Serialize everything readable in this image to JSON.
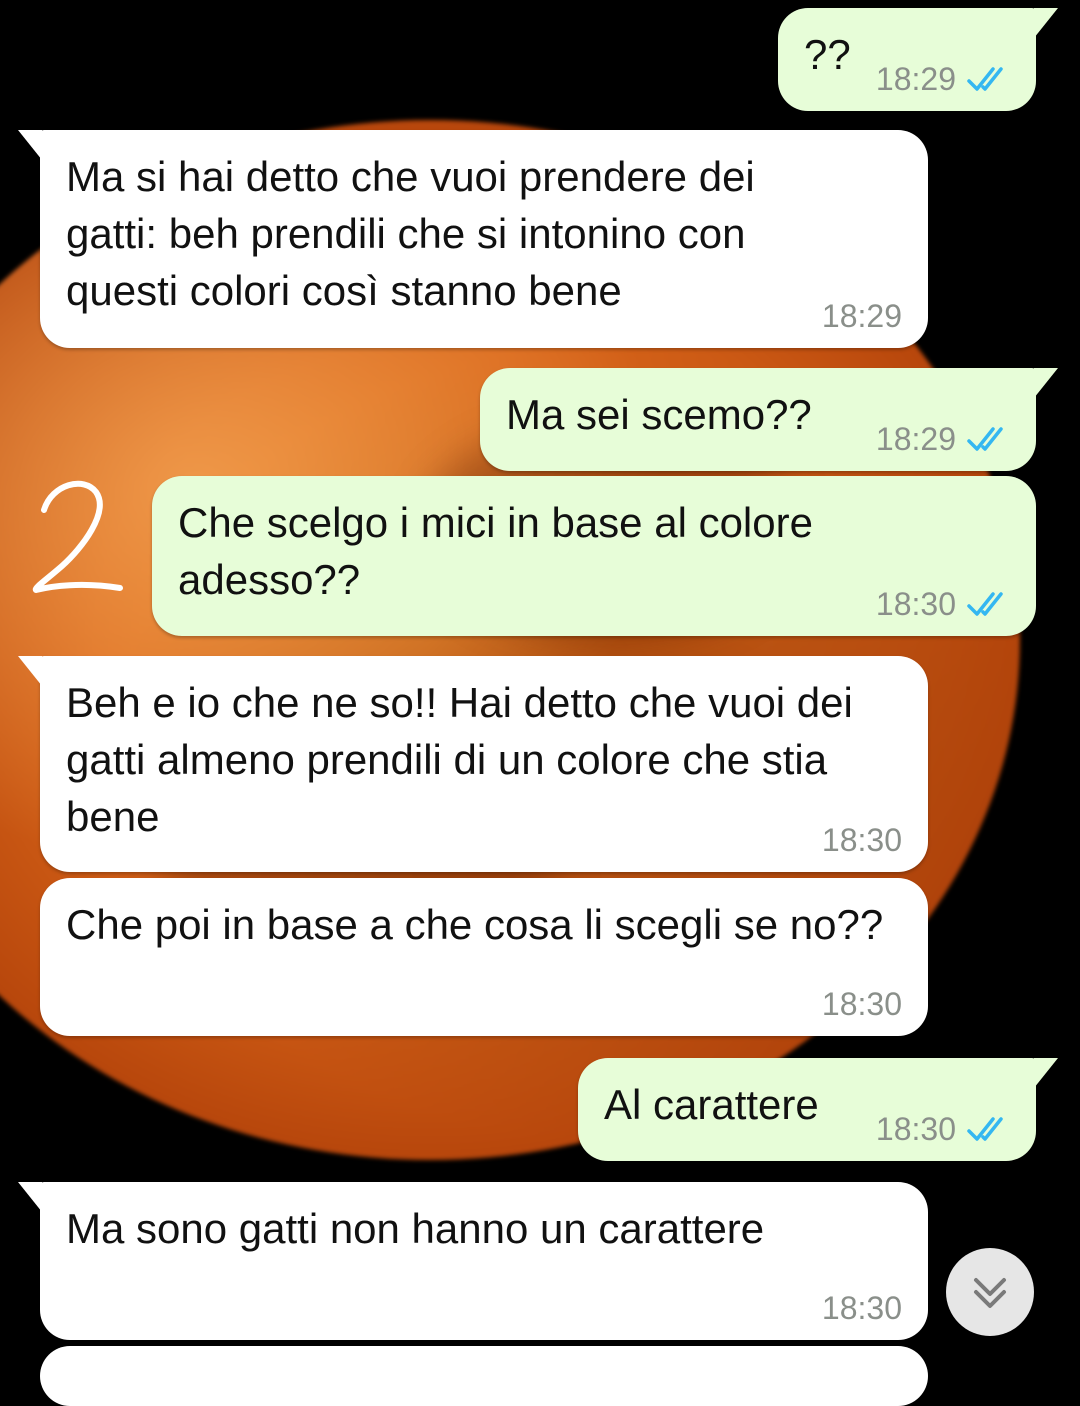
{
  "messages": [
    {
      "text": "??",
      "time": "18:29"
    },
    {
      "text": "Ma si hai detto che vuoi prendere dei gatti: beh prendili che si intonino con questi colori così stanno bene",
      "time": "18:29"
    },
    {
      "text": "Ma sei scemo??",
      "time": "18:29"
    },
    {
      "text": "Che scelgo i mici in base al colore adesso??",
      "time": "18:30"
    },
    {
      "text": "Beh e io che ne so!! Hai detto che vuoi dei gatti almeno prendili di un colore che stia bene",
      "time": "18:30"
    },
    {
      "text": "Che poi in base a che cosa li scegli se no??",
      "time": "18:30"
    },
    {
      "text": "Al carattere",
      "time": "18:30"
    },
    {
      "text": "Ma sono gatti non hanno un carattere",
      "time": "18:30"
    }
  ],
  "annotation": {
    "label": "2"
  },
  "colors": {
    "incoming_bubble": "#ffffff",
    "outgoing_bubble": "#e7fdd8",
    "read_ticks": "#34b7f1",
    "timestamp": "#8a8f8a"
  },
  "icons": {
    "read_receipt": "double-check-icon",
    "scroll_down": "chevron-double-down-icon"
  }
}
